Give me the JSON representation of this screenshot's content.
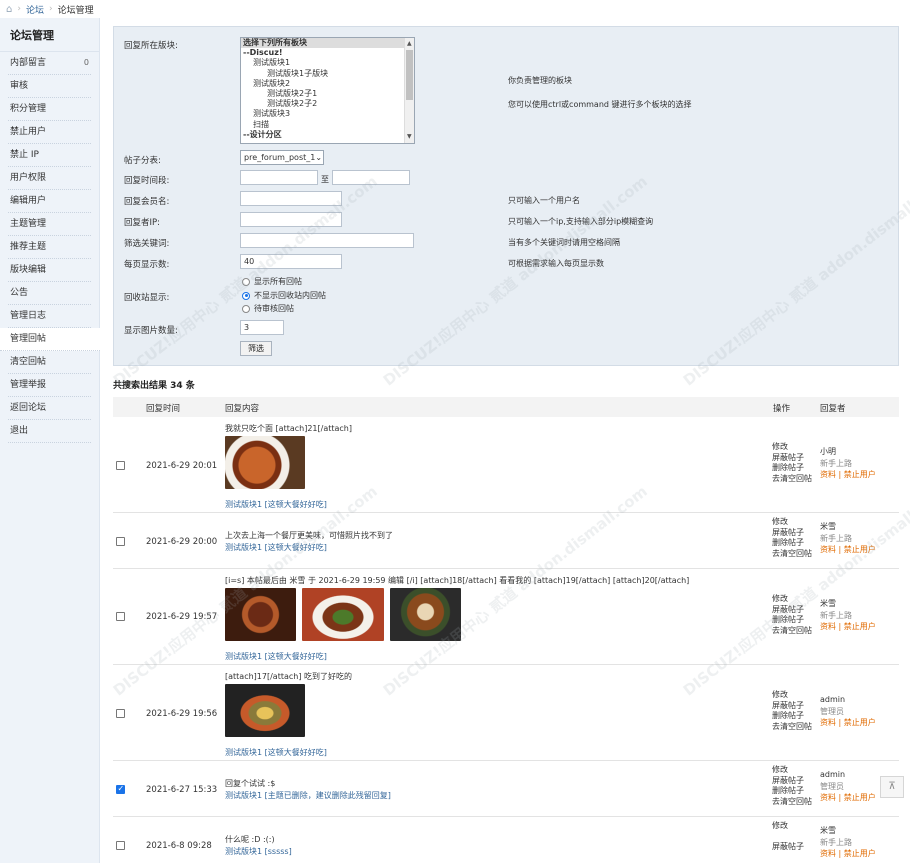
{
  "breadcrumb": {
    "items": [
      "论坛",
      "论坛管理"
    ]
  },
  "sidebar": {
    "title": "论坛管理",
    "items": [
      {
        "label": "内部留言",
        "count": "0"
      },
      {
        "label": "审核"
      },
      {
        "label": "积分管理"
      },
      {
        "label": "禁止用户"
      },
      {
        "label": "禁止 IP"
      },
      {
        "label": "用户权限"
      },
      {
        "label": "编辑用户"
      },
      {
        "label": "主题管理"
      },
      {
        "label": "推荐主题"
      },
      {
        "label": "版块编辑"
      },
      {
        "label": "公告"
      },
      {
        "label": "管理日志"
      },
      {
        "label": "管理回帖"
      },
      {
        "label": "清空回帖"
      },
      {
        "label": "管理举报"
      },
      {
        "label": "返回论坛"
      },
      {
        "label": "退出"
      }
    ],
    "active_index": 12
  },
  "filter": {
    "forum_label": "回复所在版块:",
    "forum_options": [
      "选择下列所有板块",
      "--Discuz!",
      "测试版块1",
      "测试版块1子版块",
      "测试版块2",
      "测试版块2子1",
      "测试版块2子2",
      "测试版块3",
      "扫描",
      "--设计分区"
    ],
    "forum_hint1": "你负责管理的板块",
    "forum_hint2": "您可以使用ctrl或command 键进行多个板块的选择",
    "table_label": "帖子分表:",
    "table_value": "pre_forum_post_1",
    "time_label": "回复时间段:",
    "time_sep": "至",
    "member_label": "回复会员名:",
    "member_hint": "只可输入一个用户名",
    "ip_label": "回复者IP:",
    "ip_hint": "只可输入一个ip,支持输入部分ip模糊查询",
    "keyword_label": "筛选关键词:",
    "keyword_hint": "当有多个关键词时请用空格间隔",
    "perpage_label": "每页显示数:",
    "perpage_value": "40",
    "perpage_hint": "可根据需求输入每页显示数",
    "recycle_label": "回收站显示:",
    "recycle_options": [
      "显示所有回帖",
      "不显示回收站内回帖",
      "待审核回帖"
    ],
    "recycle_selected": 1,
    "image_label": "显示图片数量:",
    "image_value": "3",
    "submit_label": "筛选"
  },
  "results": {
    "summary": "共搜索出结果 34 条",
    "columns": {
      "time": "回复时间",
      "content": "回复内容",
      "ops": "操作",
      "author": "回复者"
    },
    "ops": [
      "修改",
      "屏蔽帖子",
      "删除帖子",
      "去清空回帖"
    ],
    "user_actions": {
      "profile": "资料",
      "sep": "|",
      "ban": "禁止用户"
    },
    "rows": [
      {
        "checked": false,
        "time": "2021-6-29 20:01",
        "content": "我就只吃个面 [attach]21[/attach]",
        "images": 1,
        "forum": "测试版块1 [这顿大餐好好吃]",
        "author": "小明",
        "group": "新手上路"
      },
      {
        "checked": false,
        "time": "2021-6-29 20:00",
        "content": "上次去上海一个餐厅更美味，可惜照片找不到了",
        "images": 0,
        "forum": "测试版块1 [这顿大餐好好吃]",
        "author": "米雪",
        "group": "新手上路"
      },
      {
        "checked": false,
        "time": "2021-6-29 19:57",
        "content": "[i=s] 本帖最后由 米雪 于 2021-6-29 19:59 编辑 [/i] [attach]18[/attach] 看看我的 [attach]19[/attach] [attach]20[/attach]",
        "images": 3,
        "forum": "测试版块1 [这顿大餐好好吃]",
        "author": "米雪",
        "group": "新手上路"
      },
      {
        "checked": false,
        "time": "2021-6-29 19:56",
        "content": "[attach]17[/attach] 吃到了好吃的",
        "images": 1,
        "forum": "测试版块1 [这顿大餐好好吃]",
        "author": "admin",
        "group": "管理员"
      },
      {
        "checked": true,
        "time": "2021-6-27 15:33",
        "content": "回复个试试 :$",
        "images": 0,
        "forum": "测试版块1 [主题已删除，建议删除此残留回复]",
        "author": "admin",
        "group": "管理员"
      },
      {
        "checked": false,
        "time": "2021-6-8 09:28",
        "content": "什么呢 :D :(:)",
        "images": 0,
        "forum": "测试版块1 [sssss]",
        "author": "米雪",
        "group": "新手上路"
      }
    ]
  },
  "watermark": "DISCUZ!应用中心 贰道 addon.dismall.com"
}
